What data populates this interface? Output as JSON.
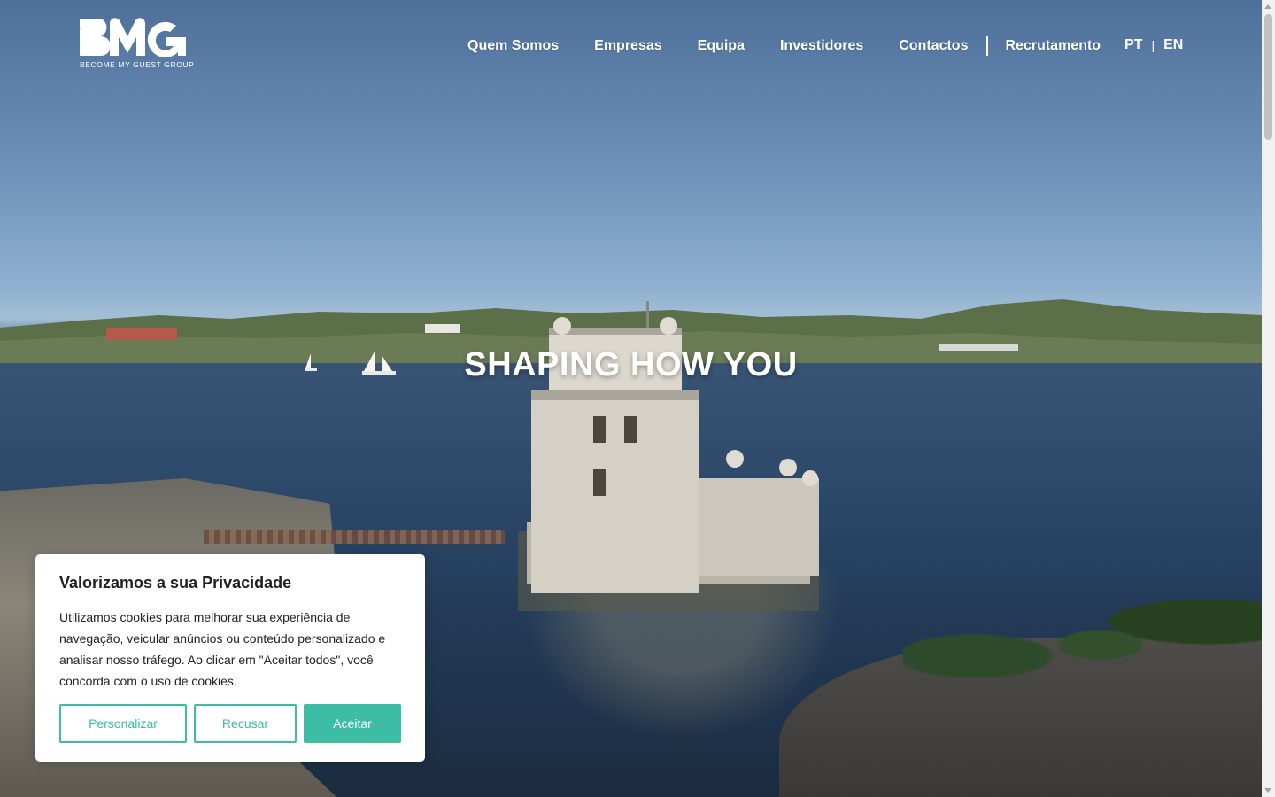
{
  "brand": {
    "logo_text": "BMG",
    "logo_subtitle": "BECOME MY GUEST GROUP"
  },
  "nav": {
    "items": [
      {
        "label": "Quem Somos"
      },
      {
        "label": "Empresas"
      },
      {
        "label": "Equipa"
      },
      {
        "label": "Investidores"
      },
      {
        "label": "Contactos"
      },
      {
        "label": "Recrutamento"
      }
    ]
  },
  "lang": {
    "pt": "PT",
    "separator": "|",
    "en": "EN"
  },
  "hero": {
    "title": "SHAPING HOW YOU"
  },
  "cookie": {
    "title": "Valorizamos a sua Privacidade",
    "text": "Utilizamos cookies para melhorar sua experiência de navegação, veicular anúncios ou conteúdo personalizado e analisar nosso tráfego. Ao clicar em \"Aceitar todos\", você concorda com o uso de cookies.",
    "customize_label": "Personalizar",
    "reject_label": "Recusar",
    "accept_label": "Aceitar"
  },
  "colors": {
    "accent": "#3dbca6",
    "text": "#212121",
    "nav_text": "#ffffff"
  },
  "icons": {
    "logo": "bmg-logo",
    "scroll_up": "scroll-up-arrow-icon",
    "scroll_down": "scroll-down-arrow-icon"
  }
}
